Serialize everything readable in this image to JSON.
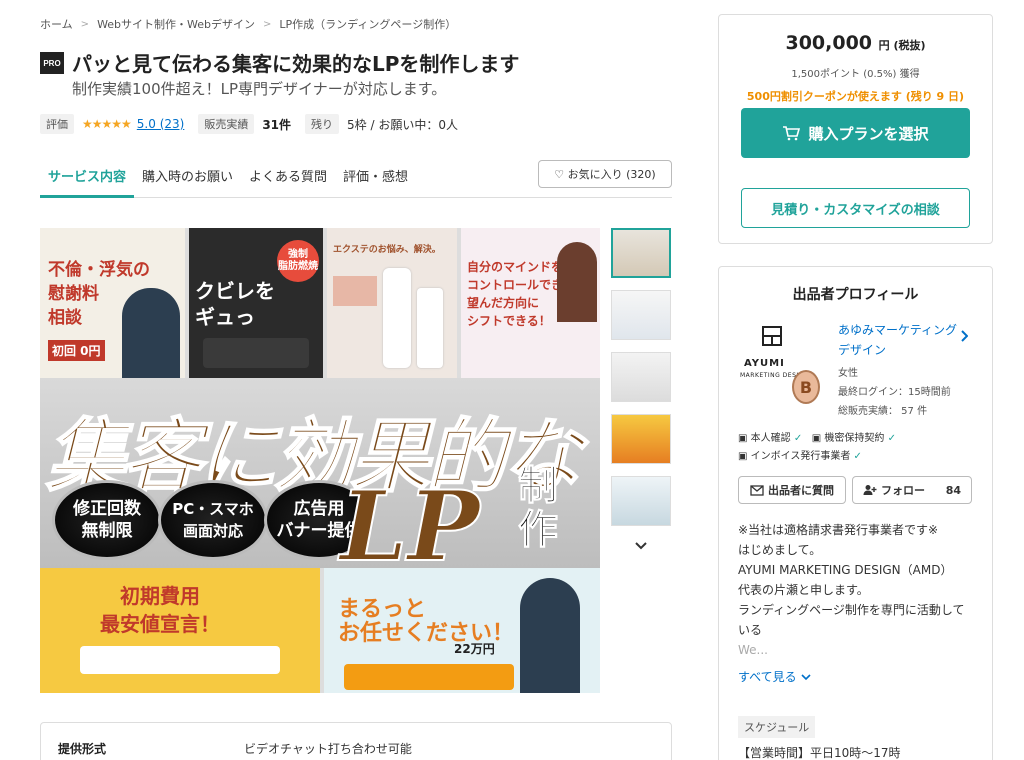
{
  "breadcrumb": [
    "ホーム",
    "Webサイト制作・Webデザイン",
    "LP作成（ランディングページ制作）"
  ],
  "pro_badge": "PRO",
  "title": "パッと見て伝わる集客に効果的なLPを制作します",
  "subtitle": "制作実績100件超え！LP専門デザイナーが対応します。",
  "meta": {
    "rating_label": "評価",
    "stars": "★★★★★",
    "rating": "5.0 (23)",
    "sales_label": "販売実績",
    "sales_value": "31件",
    "remaining_label": "残り",
    "remaining_value": "5枠 / お願い中：0人"
  },
  "tabs": [
    "サービス内容",
    "購入時のお願い",
    "よくある質問",
    "評価・感想"
  ],
  "favorite_button": "♡ お気に入り (320)",
  "hero": {
    "headline": "集客に効果的な",
    "lp": "LP",
    "seisaku": "制作",
    "features": [
      "修正回数\n無制限",
      "PC・スマホ\n画面対応",
      "広告用\nバナー提供"
    ],
    "tiles": {
      "t1": "不倫・浮気の\n慰謝料\n相談",
      "t1_sub": "初回 0円",
      "t2": "クビレを\nギュっ",
      "t2_sub": "強制\n脂肪燃焼",
      "t3": "エクステのお悩み、解決。",
      "t4": "自分のマインドを\nコントロールできれば\n望んだ方向に\nシフトできる！",
      "t5": "初期費用\n最安値宣言！",
      "t6": "まるっと\nお任せください！",
      "t6_price": "22万円"
    }
  },
  "spec": {
    "label": "提供形式",
    "value": "ビデオチャット打ち合わせ可能"
  },
  "price_card": {
    "price": "300,000",
    "price_unit": "円 (税抜)",
    "points": "1,500ポイント (0.5%) 獲得",
    "coupon": "500円割引クーポンが使えます (残り 9 日)",
    "buy_label": "購入プランを選択",
    "estimate_label": "見積り・カスタマイズの相談"
  },
  "profile": {
    "heading": "出品者プロフィール",
    "logo_name": "AYUMI",
    "logo_sub": "MARKETING DESIGN",
    "rank": "B",
    "name": "あゆみマーケティングデザイン",
    "gender": "女性",
    "last_login": "最終ログイン：15時間前",
    "total_sales": "総販売実績： 57 件",
    "verif_1": "本人確認",
    "verif_2": "機密保持契約",
    "verif_3": "インボイス発行事業者",
    "ask_label": "出品者に質問",
    "follow_label": "フォロー",
    "follow_count": "84",
    "bio": [
      "※当社は適格請求書発行事業者です※",
      "はじめまして。",
      "AYUMI MARKETING DESIGN（AMD） 代表の片瀬と申します。",
      "ランディングページ制作を専門に活動している"
    ],
    "bio_fade": "We...",
    "see_all": "すべて見る",
    "schedule_chip": "スケジュール",
    "hours": "【営業時間】平日10時〜17時"
  },
  "colors": {
    "accent": "#20a39a",
    "link": "#0070c9",
    "coupon": "#ef8f00",
    "star": "#f5a623"
  }
}
